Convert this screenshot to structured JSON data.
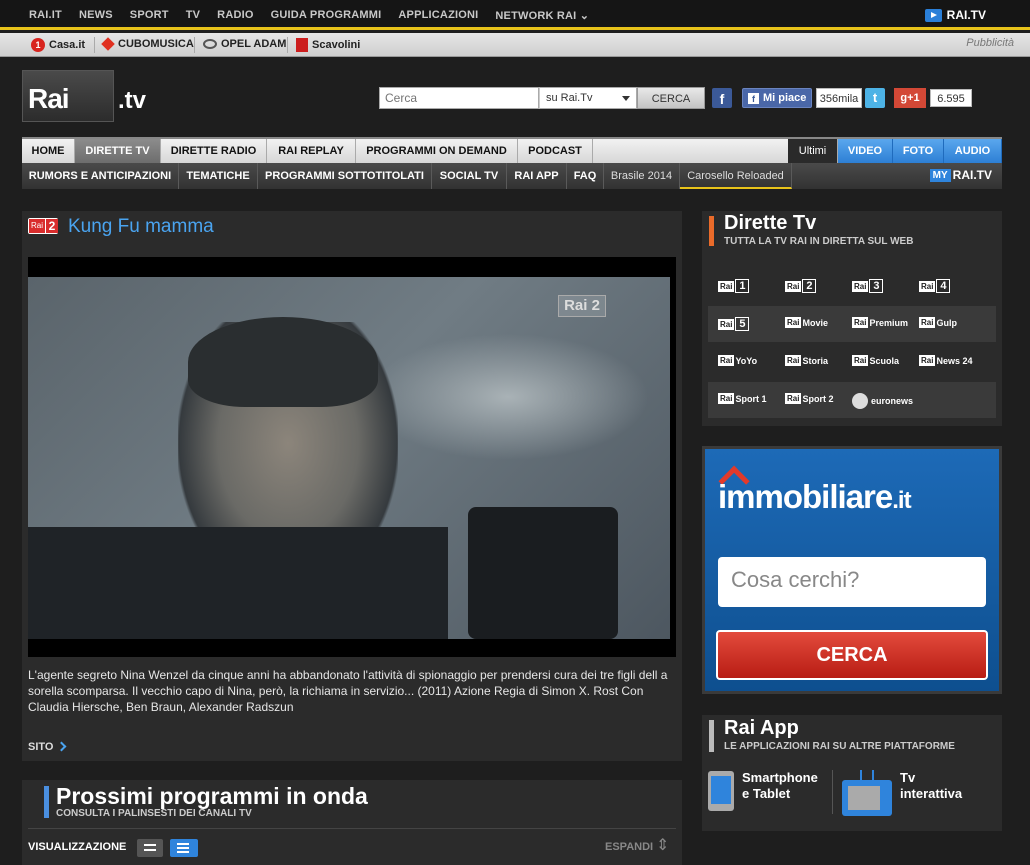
{
  "topnav": {
    "items": [
      "RAI.IT",
      "NEWS",
      "SPORT",
      "TV",
      "RADIO",
      "GUIDA PROGRAMMI",
      "APPLICAZIONI",
      "NETWORK RAI"
    ],
    "brand": "RAI.TV"
  },
  "sponsors": {
    "items": [
      "Casa.it",
      "CUBOMUSICA",
      "OPEL ADAM",
      "Scavolini"
    ],
    "label": "Pubblicità"
  },
  "header": {
    "logo_rai": "Rai",
    "logo_tv": ".tv",
    "search_placeholder": "Cerca",
    "search_scope": "su Rai.Tv",
    "search_button": "CERCA",
    "fb_like": "Mi piace",
    "fb_count": "356mila",
    "gplus": "+1",
    "gplus_count": "6.595"
  },
  "nav1": {
    "items": [
      "HOME",
      "DIRETTE TV",
      "DIRETTE RADIO",
      "RAI REPLAY",
      "PROGRAMMI ON DEMAND",
      "PODCAST"
    ],
    "ultimi": "Ultimi",
    "media": [
      "VIDEO",
      "FOTO",
      "AUDIO"
    ]
  },
  "nav2": {
    "items": [
      "RUMORS E ANTICIPAZIONI",
      "TEMATICHE",
      "PROGRAMMI SOTTOTITOLATI",
      "SOCIAL TV",
      "RAI APP",
      "FAQ",
      "Brasile 2014",
      "Carosello Reloaded"
    ],
    "my": "MY",
    "myrai": "RAI.TV"
  },
  "main": {
    "channel_badge": "Rai",
    "channel_num": "2",
    "title": "Kung Fu mamma",
    "video_logo": "Rai 2",
    "description": "L'agente segreto Nina Wenzel da cinque anni ha abbandonato l'attività di spionaggio per prendersi cura dei tre figli dell a sorella scomparsa. Il vecchio capo di Nina, però, la richiama in servizio... (2011) Azione Regia di Simon X. Rost Con Claudia Hiersche, Ben Braun, Alexander Radszun",
    "sito": "SITO"
  },
  "prossimi": {
    "title": "Prossimi programmi in onda",
    "subtitle": "CONSULTA I PALINSESTI DEI CANALI TV",
    "visualizzazione": "VISUALIZZAZIONE",
    "espandi": "ESPANDI"
  },
  "dirette": {
    "title": "Dirette Tv",
    "subtitle": "TUTTA LA TV RAI IN DIRETTA SUL WEB",
    "channels": [
      {
        "b": "Rai",
        "n": "1"
      },
      {
        "b": "Rai",
        "n": "2"
      },
      {
        "b": "Rai",
        "n": "3"
      },
      {
        "b": "Rai",
        "n": "4"
      },
      {
        "b": "Rai",
        "n": "5"
      },
      {
        "b": "Rai",
        "t": "Movie"
      },
      {
        "b": "Rai",
        "t": "Premium"
      },
      {
        "b": "Rai",
        "t": "Gulp"
      },
      {
        "b": "Rai",
        "t": "YoYo"
      },
      {
        "b": "Rai",
        "t": "Storia"
      },
      {
        "b": "Rai",
        "t": "Scuola"
      },
      {
        "b": "Rai",
        "t": "News 24"
      },
      {
        "b": "Rai",
        "t": "Sport 1"
      },
      {
        "b": "Rai",
        "t": "Sport 2"
      },
      {
        "b": "",
        "t": "euronews"
      }
    ]
  },
  "ad": {
    "logo": "immobiliare",
    "logo_tld": ".it",
    "input_placeholder": "Cosa cerchi?",
    "button": "CERCA"
  },
  "raiapp": {
    "title": "Rai App",
    "subtitle": "LE APPLICAZIONI RAI SU ALTRE PIATTAFORME",
    "smartphone_1": "Smartphone",
    "smartphone_2": "e Tablet",
    "tv_1": "Tv",
    "tv_2": "interattiva"
  }
}
